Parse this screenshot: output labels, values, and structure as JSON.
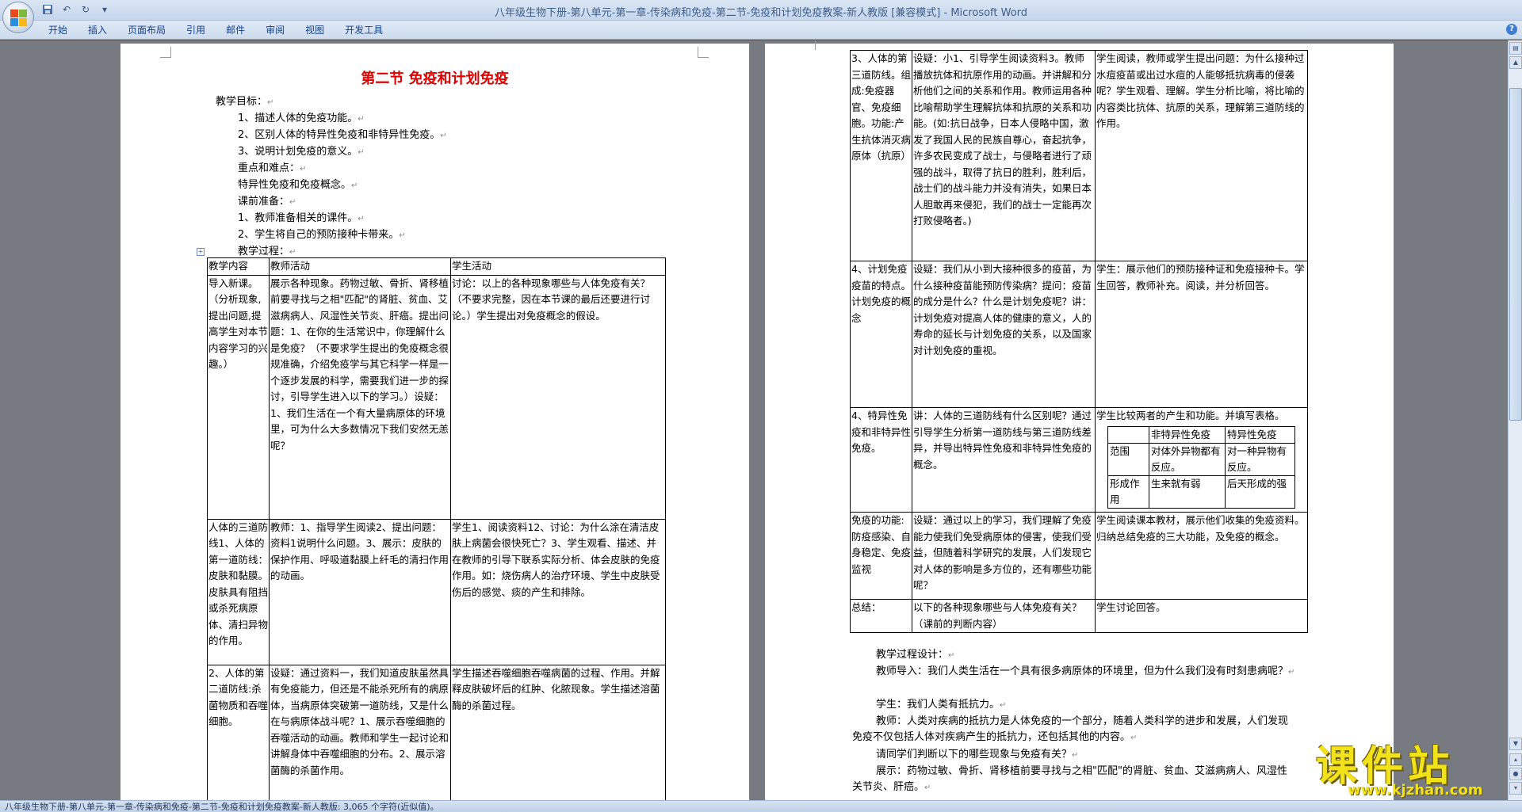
{
  "window": {
    "title": "八年级生物下册-第八单元-第一章-传染病和免疫-第二节-免疫和计划免疫教案-新人教版 [兼容模式] - Microsoft Word"
  },
  "ribbon": {
    "tabs": [
      "开始",
      "插入",
      "页面布局",
      "引用",
      "邮件",
      "审阅",
      "视图",
      "开发工具"
    ]
  },
  "page1": {
    "title": "第二节  免疫和计划免疫",
    "intro": [
      "教学目标：",
      "1、描述人体的免疫功能。",
      "2、区别人体的特异性免疫和非特异性免疫。",
      "3、说明计划免疫的意义。",
      "重点和难点：",
      "特异性免疫和免疫概念。",
      "课前准备：",
      "1、教师准备相关的课件。",
      "2、学生将自己的预防接种卡带来。",
      "教学过程："
    ],
    "table": {
      "headers": [
        "教学内容",
        "教师活动",
        "学生活动"
      ],
      "rows": [
        {
          "c1": "导入新课。（分析现象,提出问题,提高学生对本节内容学习的兴趣。）",
          "c2": "展示各种现象。药物过敏、骨折、肾移植前要寻找与之相\"匹配\"的肾脏、贫血、艾滋病病人、风湿性关节炎、肝癌。提出问题：1、在你的生活常识中，你理解什么是免疫？（不要求学生提出的免疫概念很规准确，介绍免疫学与其它科学一样是一个逐步发展的科学，需要我们进一步的探讨，引导学生进入以下的学习。）设疑：1、我们生活在一个有大量病原体的环境里，可为什么大多数情况下我们安然无恙呢？",
          "c3": "讨论：以上的各种现象哪些与人体免疫有关？（不要求完整，因在本节课的最后还要进行讨论。）学生提出对免疫概念的假设。"
        },
        {
          "c1": "人体的三道防线1、人体的第一道防线：皮肤和黏膜。皮肤具有阻挡或杀死病原体、清扫异物的作用。",
          "c2": "教师：1、指导学生阅读2、提出问题：资料1说明什么问题。3、展示：皮肤的保护作用、呼吸道黏膜上纤毛的清扫作用的动画。",
          "c3": "学生1、阅读资料12、讨论：为什么涂在清洁皮肤上病菌会很快死亡？3、学生观看、描述、并在教师的引导下联系实际分析、体会皮肤的免疫作用。如：烧伤病人的治疗环境、学生中皮肤受伤后的感觉、痰的产生和排除。"
        },
        {
          "c1": "2、人体的第二道防线:杀菌物质和吞噬细胞。",
          "c2": "设疑：通过资料一，我们知道皮肤虽然具有免疫能力，但还是不能杀死所有的病原体，当病原体突破第一道防线，又是什么在与病原体战斗呢？1、展示吞噬细胞的吞噬活动的动画。教师和学生一起讨论和讲解身体中吞噬细胞的分布。2、展示溶菌酶的杀菌作用。",
          "c3": "学生描述吞噬细胞吞噬病菌的过程、作用。并解释皮肤破坏后的红肿、化脓现象。学生描述溶菌酶的杀菌过程。"
        }
      ]
    }
  },
  "page2": {
    "table": {
      "rows": [
        {
          "c1": "3、人体的第三道防线。组成:免疫器官、免疫细胞。功能:产生抗体消灭病原体（抗原）",
          "c2": "设疑：小1、引导学生阅读资料3。教师播放抗体和抗原作用的动画。并讲解和分析他们之间的关系和作用。教师运用各种比喻帮助学生理解抗体和抗原的关系和功能。(如:抗日战争，日本人侵略中国，激发了我国人民的民族自尊心，奋起抗争，许多农民变成了战士，与侵略者进行了顽强的战斗，取得了抗日的胜利，胜利后，战士们的战斗能力并没有消失，如果日本人胆敢再来侵犯，我们的战士一定能再次打败侵略者。)",
          "c3": "学生阅读，教师或学生提出问题：为什么接种过水痘疫苗或出过水痘的人能够抵抗病毒的侵袭呢？学生观看、理解。学生分析比喻，将比喻的内容类比抗体、抗原的关系，理解第三道防线的作用。"
        },
        {
          "c1": "4、计划免疫疫苗的特点。计划免疫的概念",
          "c2": "设疑：我们从小到大接种很多的疫苗，为什么接种疫苗能预防传染病？提问：疫苗的成分是什么？什么是计划免疫呢？讲：计划免疫对提高人体的健康的意义，人的寿命的延长与计划免疫的关系，以及国家对计划免疫的重视。",
          "c3": "学生：展示他们的预防接种证和免疫接种卡。学生回答，教师补充。阅读，并分析回答。"
        },
        {
          "c1": "4、特异性免疫和非特异性免疫。",
          "c2": "讲：人体的三道防线有什么区别呢？通过引导学生分析第一道防线与第三道防线差异，并导出特异性免疫和非特异性免疫的概念。",
          "c3": "学生比较两者的产生和功能。并填写表格。"
        },
        {
          "c1": "免疫的功能:防疫感染、自身稳定、免疫监视",
          "c2": "设疑：通过以上的学习，我们理解了免疫能力使我们免受病原体的侵害，使我们受益，但随着科学研究的发展，人们发现它对人体的影响是多方位的，还有哪些功能呢？",
          "c3": "学生阅读课本教材，展示他们收集的免疫资料。归纳总结免疫的三大功能，及免疫的概念。"
        },
        {
          "c1": "总结：",
          "c2": "以下的各种现象哪些与人体免疫有关？（课前的判断内容）",
          "c3": "学生讨论回答。"
        }
      ],
      "compare": {
        "headers": [
          "",
          "非特异性免疫",
          "特异性免疫"
        ],
        "rows": [
          [
            "范围",
            "对体外异物都有反应。",
            "对一种异物有反应。"
          ],
          [
            "形成作用",
            "生来就有弱",
            "后天形成的强"
          ]
        ]
      }
    },
    "after": [
      "教学过程设计：",
      "教师导入：我们人类生活在一个具有很多病原体的环境里，但为什么我们没有时刻患病呢？",
      "学生：我们人类有抵抗力。",
      "教师：人类对疾病的抵抗力是人体免疫的一个部分，随着人类科学的进步和发展，人们发现免疫不仅包括人体对疾病产生的抵抗力，还包括其他的内容。",
      "请同学们判断以下的哪些现象与免疫有关？",
      "展示：药物过敏、骨折、肾移植前要寻找与之相\"匹配\"的肾脏、贫血、艾滋病病人、风湿性关节炎、肝癌。"
    ]
  },
  "status": {
    "text": "八年级生物下册-第八单元-第一章-传染病和免疫-第二节-免疫和计划免疫教案-新人教版: 3,065 个字符(近似值)。"
  },
  "watermark": {
    "title": "课件站",
    "url": "www.kjzhan.com"
  },
  "colors": {
    "title_red": "#e00000",
    "ribbon_text": "#15428b",
    "watermark_yellow": "#f2e21a"
  }
}
